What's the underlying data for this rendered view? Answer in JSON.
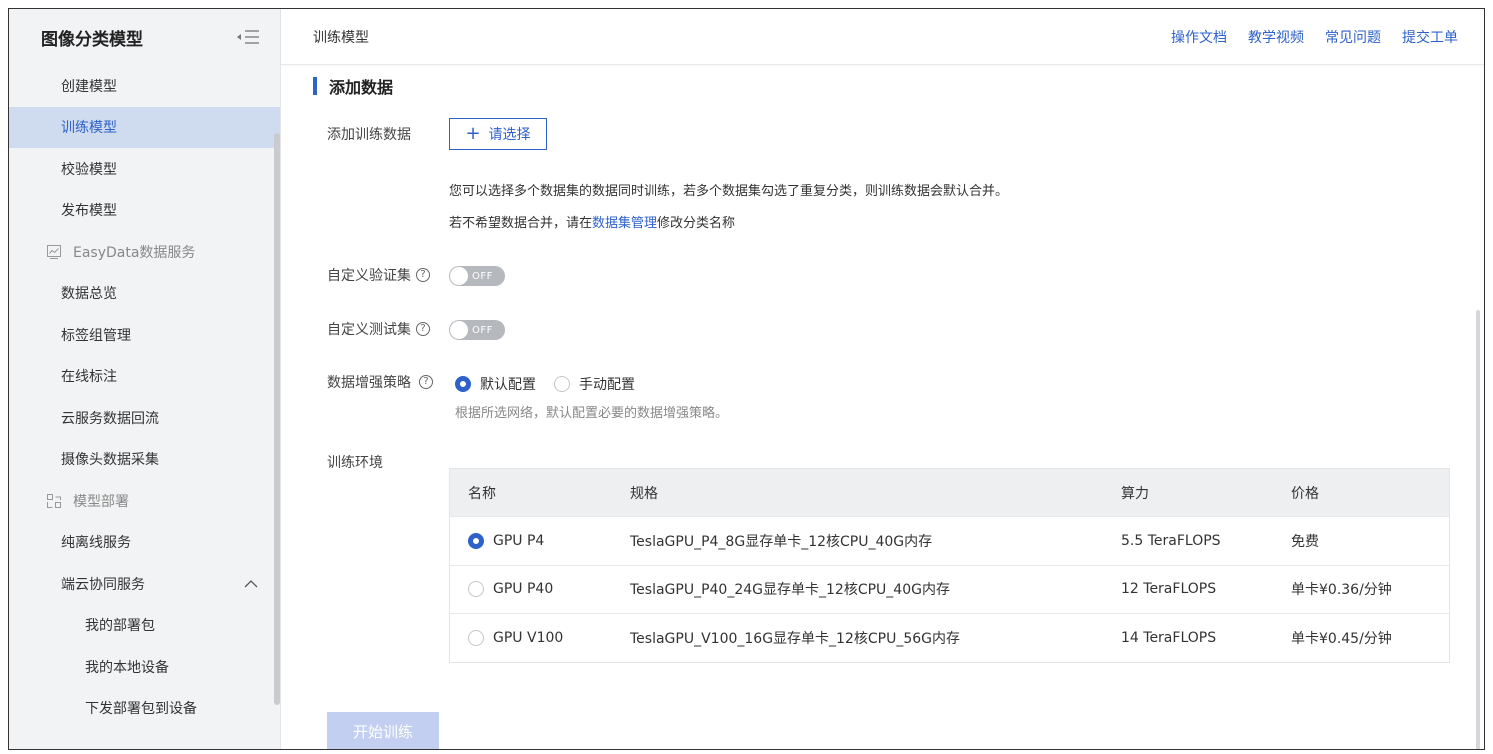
{
  "sidebar": {
    "title": "图像分类模型",
    "items": [
      {
        "label": "创建模型",
        "kind": "item"
      },
      {
        "label": "训练模型",
        "kind": "item",
        "active": true
      },
      {
        "label": "校验模型",
        "kind": "item"
      },
      {
        "label": "发布模型",
        "kind": "item"
      },
      {
        "label": "EasyData数据服务",
        "kind": "group",
        "icon": "chart-icon"
      },
      {
        "label": "数据总览",
        "kind": "item"
      },
      {
        "label": "标签组管理",
        "kind": "item"
      },
      {
        "label": "在线标注",
        "kind": "item"
      },
      {
        "label": "云服务数据回流",
        "kind": "item"
      },
      {
        "label": "摄像头数据采集",
        "kind": "item"
      },
      {
        "label": "模型部署",
        "kind": "group",
        "icon": "deploy-icon"
      },
      {
        "label": "纯离线服务",
        "kind": "item"
      },
      {
        "label": "端云协同服务",
        "kind": "item",
        "expanded": true
      },
      {
        "label": "我的部署包",
        "kind": "sub2"
      },
      {
        "label": "我的本地设备",
        "kind": "sub2"
      },
      {
        "label": "下发部署包到设备",
        "kind": "sub2"
      }
    ]
  },
  "header": {
    "breadcrumb": "训练模型",
    "links": [
      "操作文档",
      "教学视频",
      "常见问题",
      "提交工单"
    ]
  },
  "main": {
    "section_title": "添加数据",
    "add_data_label": "添加训练数据",
    "select_button": "请选择",
    "desc_line1": "您可以选择多个数据集的数据同时训练，若多个数据集勾选了重复分类，则训练数据会默认合并。",
    "desc_line2_prefix": "若不希望数据合并，请在",
    "desc_line2_link": "数据集管理",
    "desc_line2_suffix": "修改分类名称",
    "custom_val_label": "自定义验证集",
    "custom_test_label": "自定义测试集",
    "toggle_off": "OFF",
    "aug_label": "数据增强策略",
    "aug_option_default": "默认配置",
    "aug_option_manual": "手动配置",
    "aug_hint": "根据所选网络，默认配置必要的数据增强策略。",
    "env_label": "训练环境",
    "table": {
      "headers": [
        "名称",
        "规格",
        "算力",
        "价格"
      ],
      "rows": [
        {
          "name": "GPU P4",
          "spec": "TeslaGPU_P4_8G显存单卡_12核CPU_40G内存",
          "power": "5.5 TeraFLOPS",
          "price": "免费",
          "selected": true
        },
        {
          "name": "GPU P40",
          "spec": "TeslaGPU_P40_24G显存单卡_12核CPU_40G内存",
          "power": "12 TeraFLOPS",
          "price": "单卡¥0.36/分钟",
          "selected": false
        },
        {
          "name": "GPU V100",
          "spec": "TeslaGPU_V100_16G显存单卡_12核CPU_56G内存",
          "power": "14 TeraFLOPS",
          "price": "单卡¥0.45/分钟",
          "selected": false
        }
      ]
    },
    "start_button": "开始训练"
  },
  "colors": {
    "accent": "#2e61c9",
    "active_bg": "#cfdcf0",
    "sidebar_bg": "#f2f3f5"
  }
}
